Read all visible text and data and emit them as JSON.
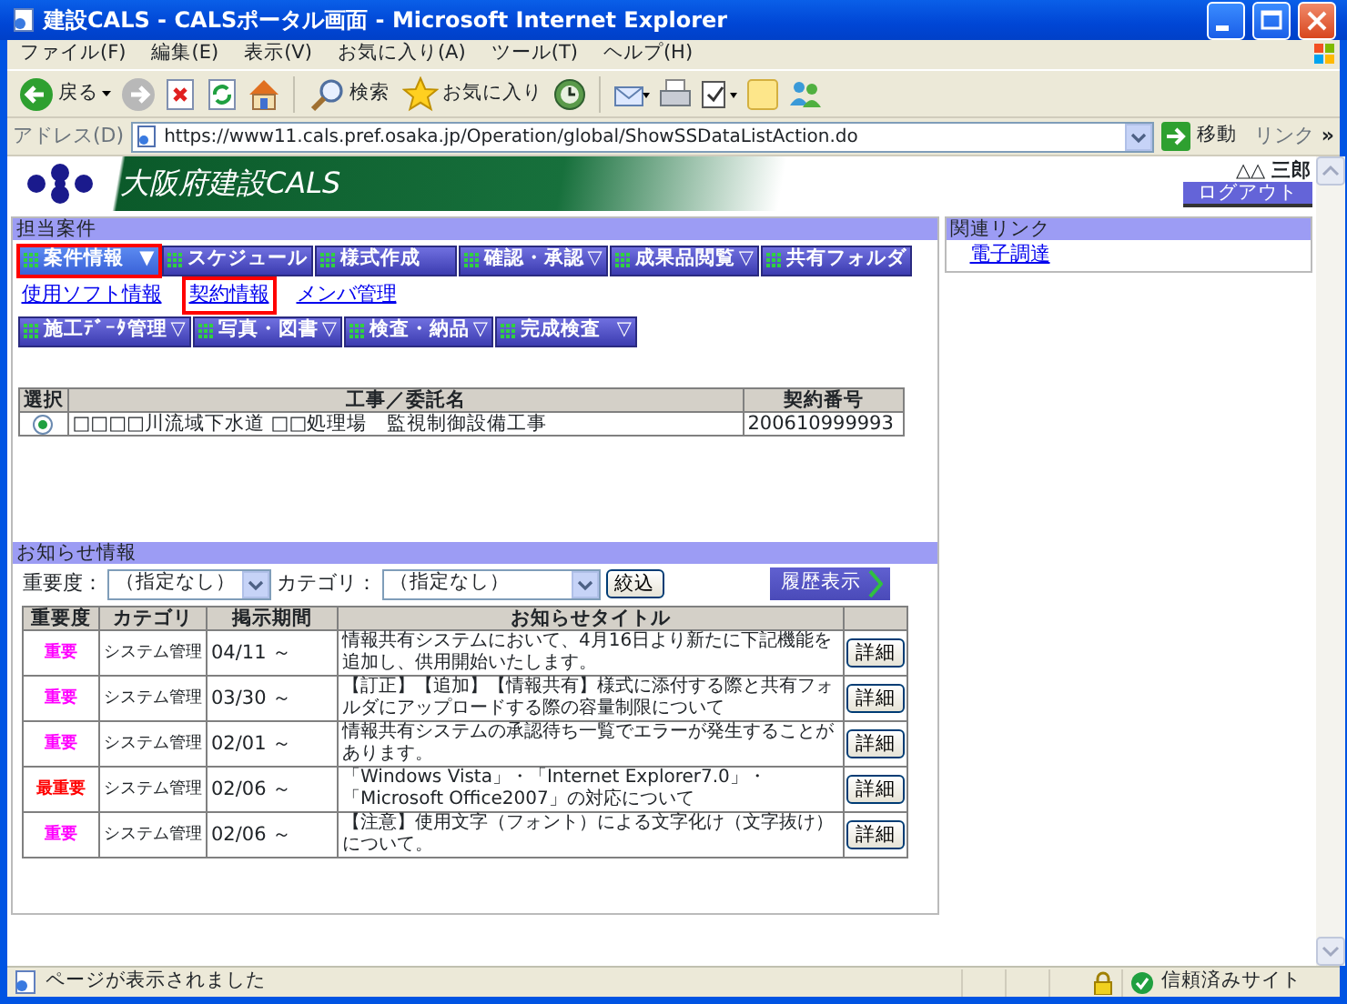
{
  "window": {
    "title": "建設CALS - CALSポータル画面 - Microsoft Internet Explorer"
  },
  "menu_bar": [
    "ファイル(F)",
    "編集(E)",
    "表示(V)",
    "お気に入り(A)",
    "ツール(T)",
    "ヘルプ(H)"
  ],
  "toolbar": [
    {
      "kind": "back",
      "label": "戻る"
    },
    {
      "kind": "forward"
    },
    {
      "kind": "stop"
    },
    {
      "kind": "refresh"
    },
    {
      "kind": "home"
    },
    {
      "kind": "separator"
    },
    {
      "kind": "search",
      "label": "検索"
    },
    {
      "kind": "favorites",
      "label": "お気に入り"
    },
    {
      "kind": "history"
    },
    {
      "kind": "separator"
    },
    {
      "kind": "mail"
    },
    {
      "kind": "print"
    },
    {
      "kind": "edit"
    },
    {
      "kind": "notes"
    },
    {
      "kind": "messenger"
    }
  ],
  "address_bar": {
    "label": "アドレス(D)",
    "url": "https://www11.cals.pref.osaka.jp/Operation/global/ShowSSDataListAction.do",
    "go": "移動",
    "links": "リンク",
    "more": "»"
  },
  "header": {
    "title": "大阪府建設CALS",
    "user": "△△ 三郎",
    "logout": "ログアウト"
  },
  "cases": {
    "title": "担当案件",
    "menu": [
      {
        "label": "案件情報",
        "arrow": "▼",
        "selected": true
      },
      {
        "label": "スケジュール",
        "selected": false
      },
      {
        "label": "様式作成",
        "selected": false
      },
      {
        "label": "確認・承認",
        "arrow": "▽",
        "selected": false
      },
      {
        "label": "成果品閲覧",
        "arrow": "▽",
        "selected": false
      },
      {
        "label": "共有フォルダ",
        "selected": false
      }
    ],
    "sub_links": [
      {
        "label": "使用ソフト情報",
        "selected": false
      },
      {
        "label": "契約情報",
        "selected": true
      },
      {
        "label": "メンバ管理",
        "selected": false
      }
    ],
    "menu_2": [
      {
        "label": "施工ﾃﾞｰﾀ管理",
        "arrow": "▽",
        "selected": false
      },
      {
        "label": "写真・図書",
        "arrow": "▽",
        "selected": false
      },
      {
        "label": "検査・納品",
        "arrow": "▽",
        "selected": false
      },
      {
        "label": "完成検査",
        "arrow": "▽",
        "selected": false
      }
    ],
    "table": {
      "columns": [
        "選択",
        "工事／委託名",
        "契約番号"
      ],
      "rows": [
        {
          "selected": true,
          "name": "□□□□川流域下水道 □□処理場　監視制御設備工事",
          "number": "200610999993"
        }
      ]
    }
  },
  "notices": {
    "title": "お知らせ情報",
    "filters": [
      {
        "label": "重要度：",
        "value": "（指定なし）"
      },
      {
        "label": "カテゴリ：",
        "value": "（指定なし）"
      }
    ],
    "filter_button": "絞込",
    "history_button": "履歴表示",
    "columns": [
      "重要度",
      "カテゴリ",
      "掲示期間",
      "お知らせタイトル"
    ],
    "rows": [
      {
        "importance": "重要",
        "color": "#ff00ff",
        "category": "システム管理",
        "period": "04/11 ～",
        "title": "情報共有システムにおいて、4月16日より新たに下記機能を追加し、供用開始いたします。",
        "button": "詳細"
      },
      {
        "importance": "重要",
        "color": "#ff00ff",
        "category": "システム管理",
        "period": "03/30 ～",
        "title": "【訂正】【追加】【情報共有】様式に添付する際と共有フォルダにアップロードする際の容量制限について",
        "button": "詳細"
      },
      {
        "importance": "重要",
        "color": "#ff00ff",
        "category": "システム管理",
        "period": "02/01 ～",
        "title": "情報共有システムの承認待ち一覧でエラーが発生することがあります。",
        "button": "詳細"
      },
      {
        "importance": "最重要",
        "color": "#ff0000",
        "category": "システム管理",
        "period": "02/06 ～",
        "title": "「Windows Vista」・「Internet Explorer7.0」・「Microsoft Office2007」の対応について",
        "button": "詳細"
      },
      {
        "importance": "重要",
        "color": "#ff00ff",
        "category": "システム管理",
        "period": "02/06 ～",
        "title": "【注意】使用文字（フォント）による文字化け（文字抜け）について。",
        "button": "詳細"
      }
    ]
  },
  "related": {
    "title": "関連リンク",
    "links": [
      "電子調達"
    ]
  },
  "status_bar": {
    "text": "ページが表示されました",
    "zone": "信頼済みサイト"
  }
}
